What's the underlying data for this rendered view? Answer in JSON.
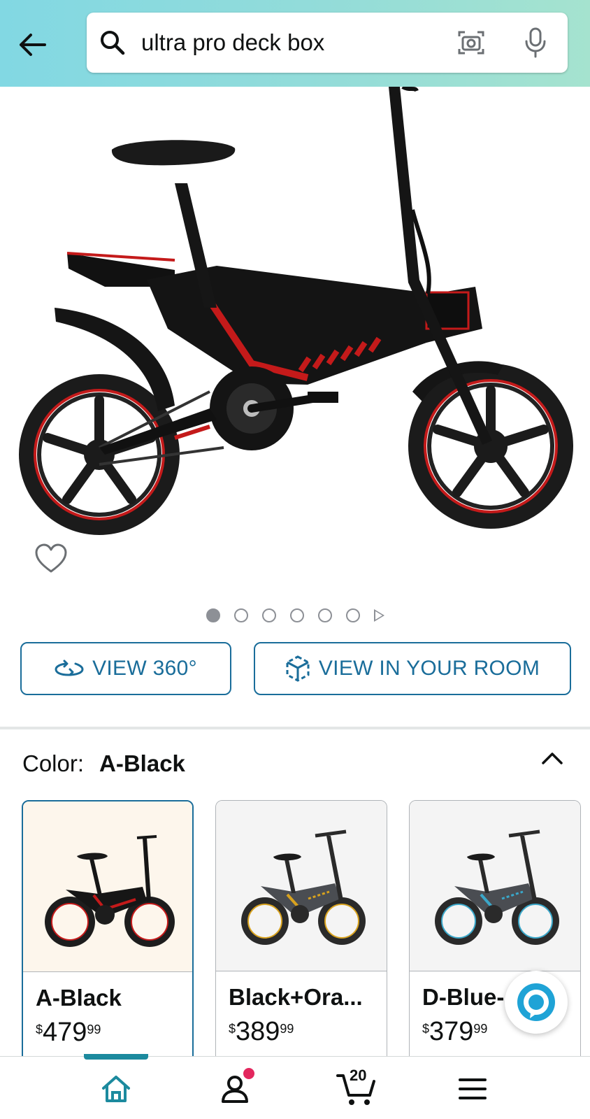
{
  "header": {
    "search_value": "ultra pro deck box",
    "icons": [
      "back-arrow-icon",
      "search-icon",
      "camera-icon",
      "microphone-icon"
    ]
  },
  "gallery": {
    "image_count": 6,
    "active_index": 0
  },
  "buttons": {
    "view_360": "VIEW 360°",
    "view_in_room": "VIEW IN YOUR ROOM"
  },
  "color": {
    "label": "Color:",
    "selected": "A-Black"
  },
  "variants": [
    {
      "name": "A-Black",
      "currency": "$",
      "whole": "479",
      "fraction": "99",
      "accent": "#c41a1a"
    },
    {
      "name": "Black+Ora...",
      "currency": "$",
      "whole": "389",
      "fraction": "99",
      "accent": "#d8a21e"
    },
    {
      "name": "D-Blue-",
      "currency": "$",
      "whole": "379",
      "fraction": "99",
      "accent": "#3aa7c9"
    }
  ],
  "nav": {
    "cart_count": "20",
    "icons": [
      "home-icon",
      "account-icon",
      "cart-icon",
      "menu-icon"
    ]
  },
  "colors": {
    "accent_link": "#1a6d9a",
    "header_gradient_start": "#82d8e3",
    "header_gradient_end": "#a5e3cf",
    "nav_active": "#1c8a9e",
    "notification": "#e3275e"
  }
}
